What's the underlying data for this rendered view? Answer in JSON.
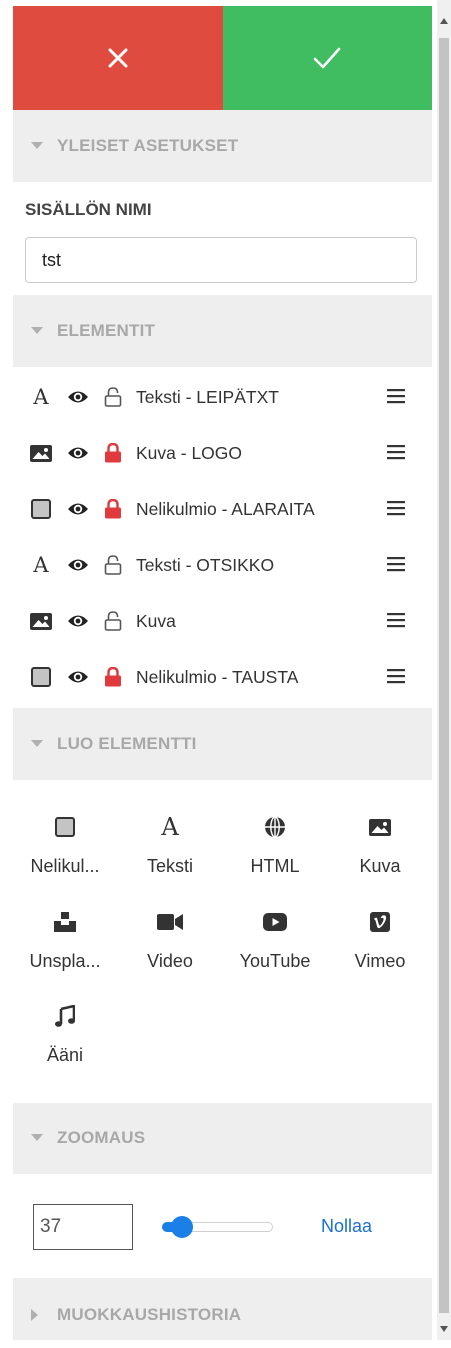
{
  "actions": {
    "cancel_icon": "close-icon",
    "confirm_icon": "check-icon"
  },
  "sections": {
    "general": {
      "title": "YLEISET ASETUKSET",
      "expanded": true
    },
    "elements": {
      "title": "ELEMENTIT",
      "expanded": true
    },
    "create": {
      "title": "LUO ELEMENTTI",
      "expanded": true
    },
    "zoom": {
      "title": "ZOOMAUS",
      "expanded": true
    },
    "history": {
      "title": "MUOKKAUSHISTORIA",
      "expanded": false
    }
  },
  "general": {
    "name_label": "SISÄLLÖN NIMI",
    "name_value": "tst"
  },
  "elements": [
    {
      "type": "text",
      "label": "Teksti - LEIPÄTXT",
      "locked": false
    },
    {
      "type": "image",
      "label": "Kuva - LOGO",
      "locked": true
    },
    {
      "type": "rectangle",
      "label": "Nelikulmio - ALARAITA",
      "locked": true
    },
    {
      "type": "text",
      "label": "Teksti - OTSIKKO",
      "locked": false
    },
    {
      "type": "image",
      "label": "Kuva",
      "locked": false
    },
    {
      "type": "rectangle",
      "label": "Nelikulmio - TAUSTA",
      "locked": true
    }
  ],
  "create_items": [
    {
      "icon": "rectangle-icon",
      "label": "Nelikul..."
    },
    {
      "icon": "text-icon",
      "label": "Teksti"
    },
    {
      "icon": "globe-icon",
      "label": "HTML"
    },
    {
      "icon": "image-icon",
      "label": "Kuva"
    },
    {
      "icon": "unsplash-icon",
      "label": "Unspla..."
    },
    {
      "icon": "video-camera-icon",
      "label": "Video"
    },
    {
      "icon": "youtube-icon",
      "label": "YouTube"
    },
    {
      "icon": "vimeo-icon",
      "label": "Vimeo"
    },
    {
      "icon": "music-icon",
      "label": "Ääni"
    }
  ],
  "zoom": {
    "value": "37",
    "slider_fraction": 0.18,
    "reset_label": "Nollaa"
  },
  "colors": {
    "cancel": "#e04b40",
    "confirm": "#3fbd60",
    "accent": "#1a7fe6",
    "lock_red": "#e0393e",
    "section_text": "#a8a8a8"
  }
}
